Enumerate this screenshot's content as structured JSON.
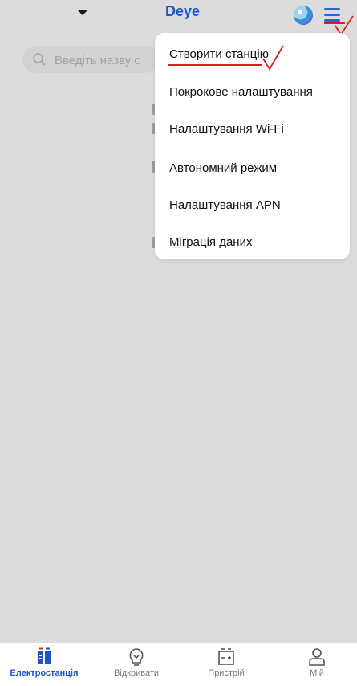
{
  "header": {
    "logo_text": "Deye",
    "dropdown_caret": "caret-down-icon",
    "avatar": "avatar-icon",
    "menu_icon": "menu-icon"
  },
  "search": {
    "placeholder": "Введіть назву с"
  },
  "menu": {
    "items": [
      {
        "label": "Створити станцію"
      },
      {
        "label": "Покрокове налаштування"
      },
      {
        "label": "Налаштування Wi-Fi"
      },
      {
        "label": "Автономний режим"
      },
      {
        "label": "Налаштування APN"
      },
      {
        "label": "Міграція даних"
      }
    ]
  },
  "tabs": [
    {
      "label": "Електростанція",
      "icon": "power-station-icon",
      "active": true
    },
    {
      "label": "Відкривати",
      "icon": "lightbulb-icon",
      "active": false
    },
    {
      "label": "Пристрій",
      "icon": "battery-device-icon",
      "active": false
    },
    {
      "label": "Мій",
      "icon": "person-icon",
      "active": false
    }
  ],
  "colors": {
    "accent": "#1a55c9",
    "annotation_red": "#d81f1f",
    "background": "#dcdcdc"
  }
}
